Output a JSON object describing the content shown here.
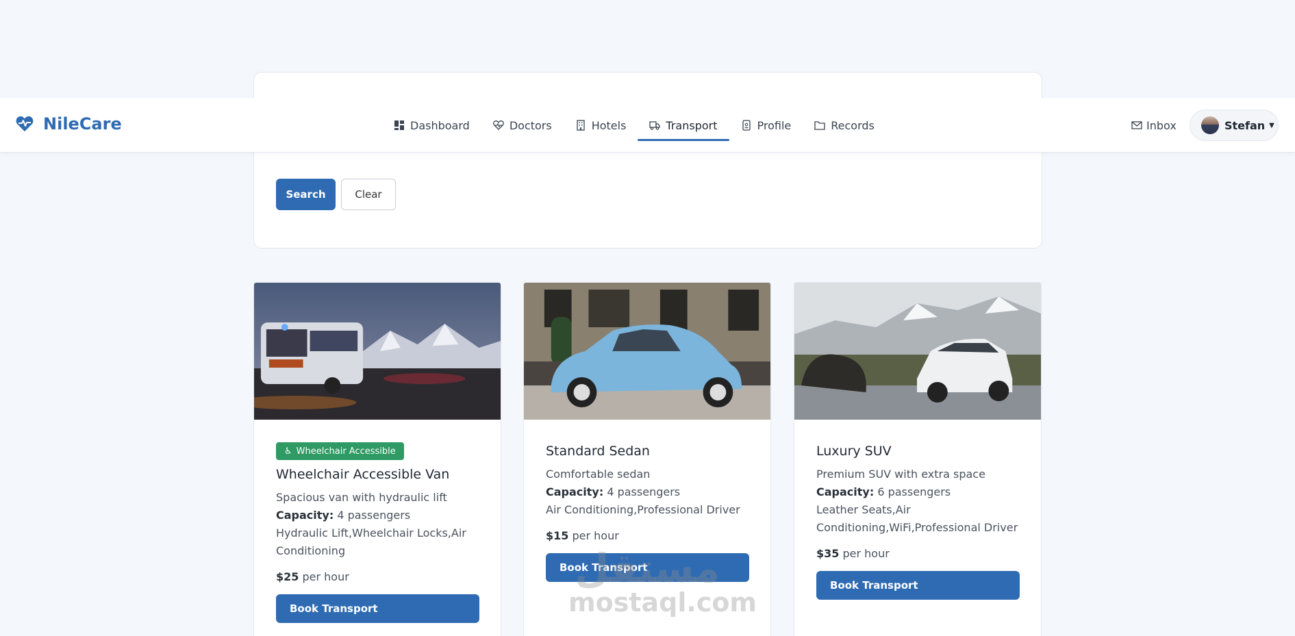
{
  "brand": {
    "name": "NileCare",
    "accent": "#2f6bb3"
  },
  "nav": {
    "items": [
      {
        "label": "Dashboard",
        "icon": "dashboard-icon"
      },
      {
        "label": "Doctors",
        "icon": "heart-pulse-icon"
      },
      {
        "label": "Hotels",
        "icon": "building-icon"
      },
      {
        "label": "Transport",
        "icon": "truck-icon",
        "active": true
      },
      {
        "label": "Profile",
        "icon": "id-badge-icon"
      },
      {
        "label": "Records",
        "icon": "folder-icon"
      }
    ],
    "inbox_label": "Inbox",
    "user_name": "Stefan"
  },
  "search": {
    "search_label": "Search",
    "clear_label": "Clear"
  },
  "vehicles": [
    {
      "badge": "Wheelchair Accessible",
      "title": "Wheelchair Accessible Van",
      "description": "Spacious van with hydraulic lift",
      "capacity_label": "Capacity:",
      "capacity_value": "4 passengers",
      "features": "Hydraulic Lift,Wheelchair Locks,Air Conditioning",
      "price": "$25",
      "price_unit": "per hour",
      "button": "Book Transport"
    },
    {
      "title": "Standard Sedan",
      "description": "Comfortable sedan",
      "capacity_label": "Capacity:",
      "capacity_value": "4 passengers",
      "features": "Air Conditioning,Professional Driver",
      "price": "$15",
      "price_unit": "per hour",
      "button": "Book Transport"
    },
    {
      "title": "Luxury SUV",
      "description": "Premium SUV with extra space",
      "capacity_label": "Capacity:",
      "capacity_value": "6 passengers",
      "features": "Leather Seats,Air Conditioning,WiFi,Professional Driver",
      "price": "$35",
      "price_unit": "per hour",
      "button": "Book Transport"
    }
  ],
  "watermark": {
    "arabic": "مستقل",
    "latin": "mostaql.com"
  }
}
